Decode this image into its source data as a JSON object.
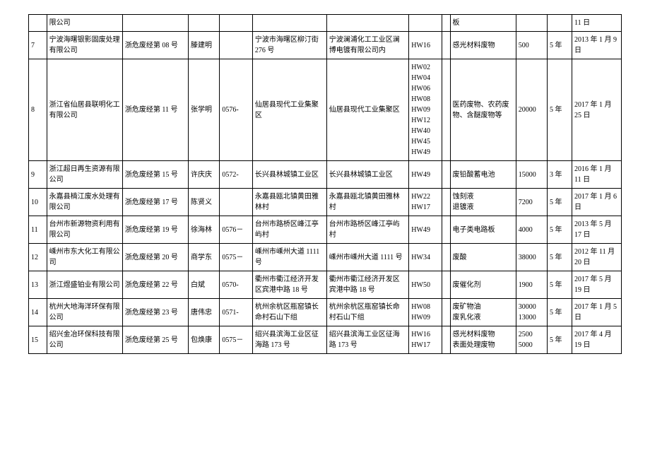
{
  "rows": [
    {
      "idx": "",
      "company": "限公司",
      "license": "",
      "rep": "",
      "phone": "",
      "addr": "",
      "loc": "",
      "codes": "",
      "cls": "",
      "desc": "板",
      "cap": "",
      "term": "",
      "date": "11 日"
    },
    {
      "idx": "7",
      "company": "宁波海曙银影固废处理有限公司",
      "license": "浙危废经第 08 号",
      "rep": "滕建明",
      "phone": "",
      "addr": "宁波市海曙区柳汀街 276 号",
      "loc": "宁波澜浦化工工业区澜博电镀有限公司内",
      "codes": "HW16",
      "cls": "",
      "desc": "感光材料废物",
      "cap": "500",
      "term": "5 年",
      "date": "2013 年 1 月 9 日"
    },
    {
      "idx": "8",
      "company": "浙江省仙居县联明化工有限公司",
      "license": "浙危废经第 11 号",
      "rep": "张学明",
      "phone": "0576-",
      "addr": "仙居县现代工业集聚区",
      "loc": "仙居县现代工业集聚区",
      "codes": "HW02\nHW04\nHW06\nHW08\nHW09\nHW12\nHW40\nHW45\nHW49",
      "cls": "",
      "desc": "医药废物、农药废物、含醚废物等",
      "cap": "20000",
      "term": "5 年",
      "date": "2017 年 1 月 25 日"
    },
    {
      "idx": "9",
      "company": "浙江超日再生资源有限公司",
      "license": "浙危废经第 15 号",
      "rep": "许庆庆",
      "phone": "0572-",
      "addr": "长兴县林城镇工业区",
      "loc": "长兴县林城镇工业区",
      "codes": "HW49",
      "cls": "",
      "desc": "废铅酸蓄电池",
      "cap": "15000",
      "term": "3 年",
      "date": "2016 年 1 月 11 日"
    },
    {
      "idx": "10",
      "company": "永嘉县楠江废水处理有限公司",
      "license": "浙危废经第 17 号",
      "rep": "陈贤义",
      "phone": "",
      "addr": "永嘉县瓯北镇黄田雅林村",
      "loc": "永嘉县瓯北镇黄田雅林村",
      "codes": "HW22\nHW17",
      "cls": "",
      "desc": "蚀刻液\n退镀液",
      "cap": "7200",
      "term": "5 年",
      "date": "2017 年 1 月 6 日"
    },
    {
      "idx": "11",
      "company": "台州市新源物资利用有限公司",
      "license": "浙危废经第 19 号",
      "rep": "徐海林",
      "phone": "0576－",
      "addr": "台州市路桥区峰江亭屿村",
      "loc": "台州市路桥区峰江亭屿村",
      "codes": "HW49",
      "cls": "",
      "desc": "电子类电路板",
      "cap": "4000",
      "term": "5 年",
      "date": "2013 年 5 月 17 日"
    },
    {
      "idx": "12",
      "company": "嵊州市东大化工有限公司",
      "license": "浙危废经第 20 号",
      "rep": "商学东",
      "phone": "0575－",
      "addr": "嵊州市嵊州大道 1111 号",
      "loc": "嵊州市嵊州大道 1111 号",
      "codes": "HW34",
      "cls": "",
      "desc": "废酸",
      "cap": "38000",
      "term": "5 年",
      "date": "2012 年 11 月 20 日"
    },
    {
      "idx": "13",
      "company": "浙江煜盛铂业有限公司",
      "license": "浙危废经第 22 号",
      "rep": "白斌",
      "phone": "0570-",
      "addr": "衢州市衢江经济开发区宾港中路 18 号",
      "loc": "衢州市衢江经济开发区宾港中路 18 号",
      "codes": "HW50",
      "cls": "",
      "desc": "废催化剂",
      "cap": "1900",
      "term": "5 年",
      "date": "2017 年 5 月 19 日"
    },
    {
      "idx": "14",
      "company": "杭州大地海洋环保有限公司",
      "license": "浙危废经第 23 号",
      "rep": "唐伟忠",
      "phone": "0571-",
      "addr": "杭州余杭区瓶窑镇长命村石山下组",
      "loc": "杭州余杭区瓶窑镇长命村石山下组",
      "codes": "HW08\nHW09",
      "cls": "",
      "desc": "废矿物油\n废乳化液",
      "cap": "30000\n13000",
      "term": "5 年",
      "date": "2017 年 1 月 5 日"
    },
    {
      "idx": "15",
      "company": "绍兴金冶环保科技有限公司",
      "license": "浙危废经第 25 号",
      "rep": "包焕康",
      "phone": "0575－",
      "addr": "绍兴县滨海工业区征海路 173 号",
      "loc": "绍兴县滨海工业区征海路 173 号",
      "codes": "HW16\nHW17",
      "cls": "",
      "desc": "感光材料废物\n表面处理废物",
      "cap": "2500\n5000",
      "term": "5 年",
      "date": "2017 年 4 月 19 日"
    }
  ]
}
